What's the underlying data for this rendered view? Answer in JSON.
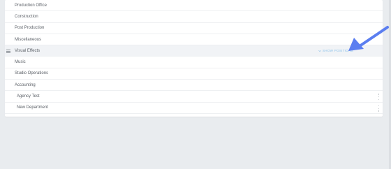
{
  "departments": [
    {
      "label": "Production Office",
      "type": "department"
    },
    {
      "label": "Construction",
      "type": "department"
    },
    {
      "label": "Post Production",
      "type": "department"
    },
    {
      "label": "Miscellaneous",
      "type": "department"
    },
    {
      "label": "Visual Effects",
      "type": "department"
    },
    {
      "label": "Music",
      "type": "department"
    },
    {
      "label": "Studio Operations",
      "type": "department"
    },
    {
      "label": "Accounting",
      "type": "department"
    },
    {
      "label": "Agency Test",
      "type": "custom"
    },
    {
      "label": "New Department",
      "type": "custom"
    }
  ],
  "hover_row": {
    "show_positions_label": "SHOW POSITIONS"
  },
  "colors": {
    "background": "#e9ecef",
    "card": "#ffffff",
    "text": "#5a5f66",
    "link": "#8cc2ea",
    "annotation_arrow": "#5b7ef0"
  },
  "icons": {
    "drag_handle": "drag-handle-icon",
    "show_positions": "chevron-down-icon",
    "row_menu": "kebab-menu-icon",
    "annotation": "pointer-arrow-icon"
  }
}
